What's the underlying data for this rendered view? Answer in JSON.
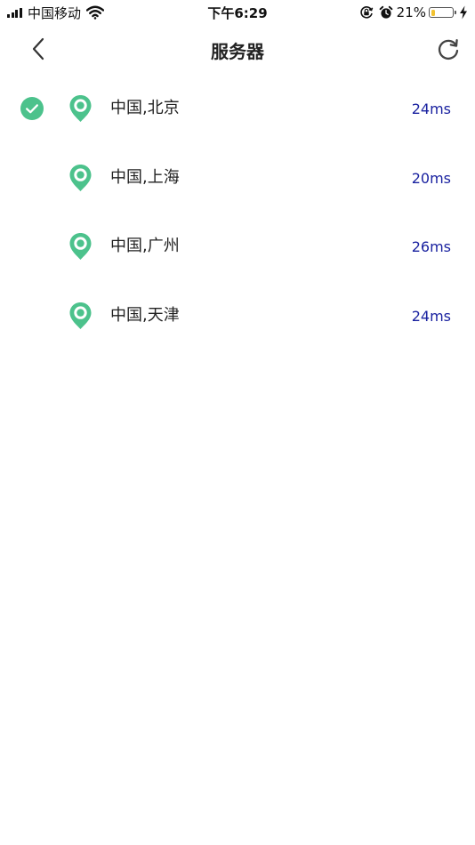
{
  "status_bar": {
    "carrier": "中国移动",
    "time": "下午6:29",
    "battery_percent_label": "21%",
    "battery_level": 0.21,
    "icons": [
      "signal-icon",
      "wifi-icon",
      "orientation-lock-icon",
      "alarm-icon",
      "battery-icon",
      "charging-icon"
    ]
  },
  "nav": {
    "title": "服务器",
    "back_icon": "chevron-left-icon",
    "refresh_icon": "refresh-icon"
  },
  "servers": [
    {
      "name": "中国,北京",
      "latency": "24ms",
      "selected": true
    },
    {
      "name": "中国,上海",
      "latency": "20ms",
      "selected": false
    },
    {
      "name": "中国,广州",
      "latency": "26ms",
      "selected": false
    },
    {
      "name": "中国,天津",
      "latency": "24ms",
      "selected": false
    }
  ],
  "colors": {
    "accent_green": "#4cc28c",
    "latency_blue": "#1a22a0",
    "battery_yellow": "#f2c231",
    "text_dark": "#222222"
  }
}
